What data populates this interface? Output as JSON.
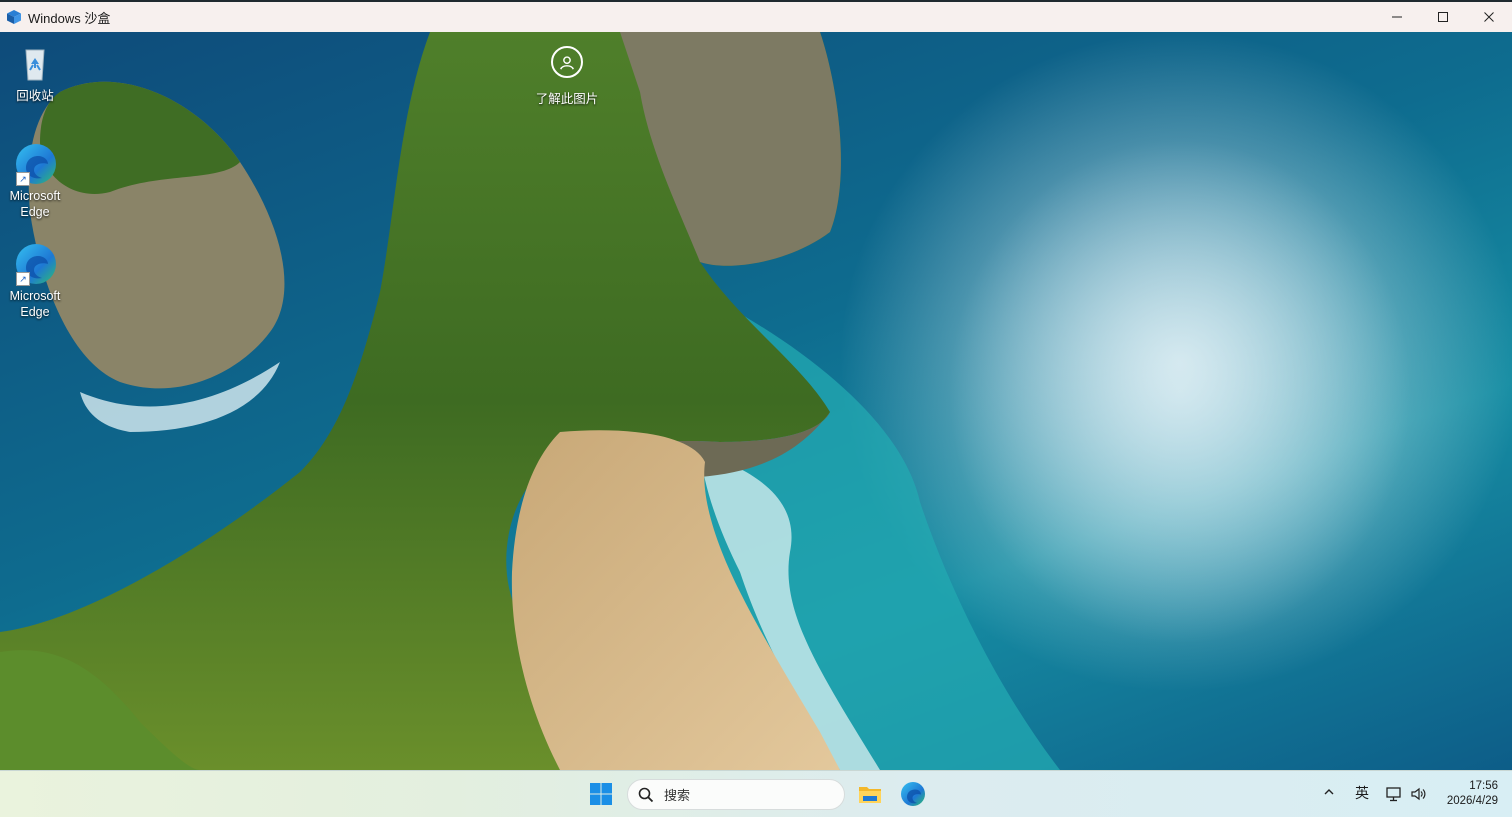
{
  "window": {
    "title": "Windows 沙盒",
    "controls": {
      "minimize": "minimize-icon",
      "maximize": "maximize-icon",
      "close": "close-icon"
    }
  },
  "desktop": {
    "icons": [
      {
        "label": "回收站",
        "icon": "recycle-bin-icon"
      },
      {
        "label": "Microsoft Edge",
        "icon": "edge-icon"
      },
      {
        "label": "Microsoft Edge",
        "icon": "edge-icon"
      }
    ],
    "spotlight": {
      "label": "了解此图片",
      "icon": "camera-info-icon"
    }
  },
  "taskbar": {
    "search": {
      "placeholder": "搜索"
    },
    "apps": [
      "file-explorer-icon",
      "edge-icon"
    ],
    "tray": {
      "ime": "英"
    },
    "clock": {
      "time": "17:56",
      "date": "2026/4/29"
    }
  },
  "colors": {
    "accent": "#1e78d4",
    "taskbar": "#e3efdf",
    "titlebar": "#f7f0ee"
  }
}
